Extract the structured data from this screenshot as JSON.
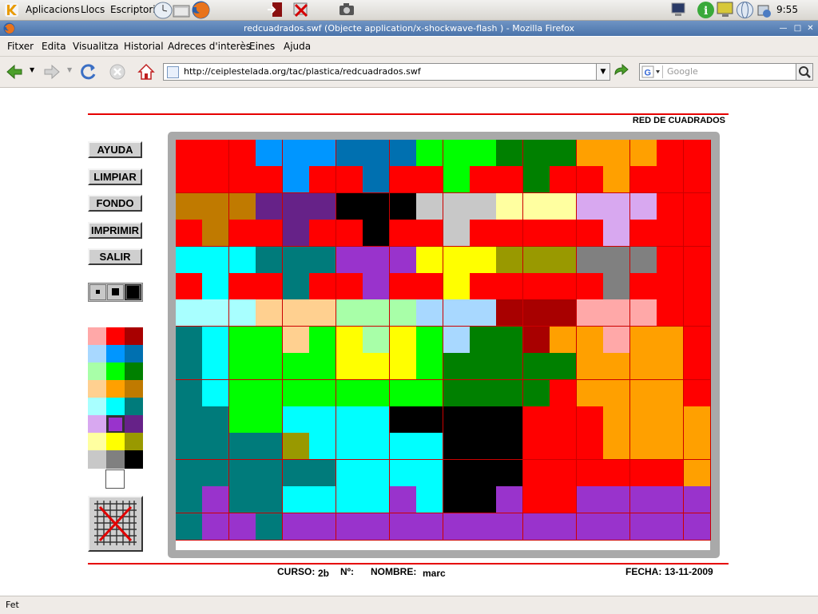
{
  "panel": {
    "menu_apps": "Aplicacions",
    "menu_places": "Llocs",
    "menu_desktop": "Escriptori",
    "clock": "9:55"
  },
  "window": {
    "title": "redcuadrados.swf (Objecte application/x-shockwave-flash ) - Mozilla Firefox"
  },
  "menubar": [
    "Fitxer",
    "Edita",
    "Visualitza",
    "Historial",
    "Adreces d'interès",
    "Eines",
    "Ajuda"
  ],
  "nav": {
    "url": "http://ceiplestelada.org/tac/plastica/redcuadrados.swf",
    "search_placeholder": "Google"
  },
  "app": {
    "title": "RED DE CUADRADOS",
    "buttons": [
      "AYUDA",
      "LIMPIAR",
      "FONDO",
      "IMPRIMIR",
      "SALIR"
    ],
    "palette": [
      [
        "#ffa8a8",
        "#ff0000",
        "#a80000"
      ],
      [
        "#a8d8ff",
        "#0096ff",
        "#0070b0"
      ],
      [
        "#a8ffa8",
        "#00ff00",
        "#008000"
      ],
      [
        "#ffd090",
        "#ffa000",
        "#c07a00"
      ],
      [
        "#a8ffff",
        "#00ffff",
        "#007b7b"
      ],
      [
        "#d8a8f0",
        "#9933cc",
        "#662288"
      ],
      [
        "#ffffa0",
        "#ffff00",
        "#999900"
      ],
      [
        "#c8c8c8",
        "#808080",
        "#000000"
      ]
    ],
    "selected_color": "#9933cc",
    "grid": {
      "rows": 15,
      "cols": 20,
      "colors": {
        "R": "#ff0000",
        "B": "#0096ff",
        "b": "#0070b0",
        "G": "#00ff00",
        "g": "#008000",
        "O": "#ffa000",
        "o": "#c07a00",
        "p": "#662288",
        "K": "#000000",
        "l": "#c8c8c8",
        "y": "#ffffa0",
        "v": "#d8a8f0",
        "C": "#00ffff",
        "T": "#007b7b",
        "P": "#9933cc",
        "Y": "#ffff00",
        "L": "#999900",
        "M": "#808080",
        "c": "#a8ffff",
        "h": "#ffd090",
        "q": "#a8ffa8",
        "s": "#a8d8ff",
        "D": "#a80000",
        "k": "#ffa8a8"
      },
      "cells": [
        "RRRBBBbbbGGGgggOOORR",
        "RRRRBRRbRRGRRgRRORRR",
        "ooopppKKKlllyyyvvvRR",
        "RoRRpRRKRRlRRRRRvRRR",
        "CCCTTTPPPYYYLLLMMMRR",
        "RCRRTRRPRRYRRRRRMRRR",
        "ccchhhqqqsssDDDkkkRR",
        "TCGGhGYqYGsggDOOkOOR",
        "TCGGGGYYYGgggggOOOOR",
        "TCGGGGGGGGggggROOOOR",
        "TTGGCCCCKKKKKRRROOOO",
        "TTTTLCCCCCKKKRRROOOO",
        "TTTTTTCCCCKKKRRRRRRO",
        "TPTTCCCCPCKKPRRPPPPP",
        "TPPTPPPPPPPPPPPPPPPP"
      ]
    },
    "footer": {
      "curso_label": "CURSO:",
      "curso_value": "2b",
      "num_label": "Nº:",
      "nombre_label": "NOMBRE:",
      "nombre_value": "marc",
      "fecha_label": "FECHA:",
      "fecha_value": "13-11-2009"
    }
  },
  "status": "Fet"
}
